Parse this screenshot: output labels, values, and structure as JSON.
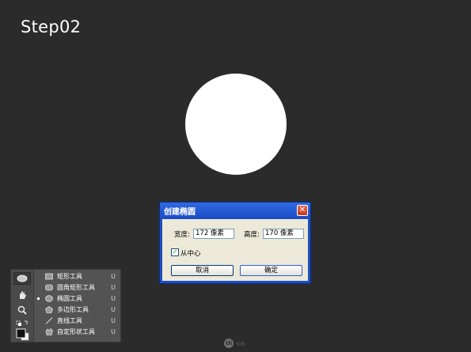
{
  "step_title": "Step02",
  "canvas": {
    "shape": "circle",
    "fill": "#ffffff"
  },
  "dialog": {
    "title": "创建椭圆",
    "close_icon": "close-icon",
    "width_label": "宽度:",
    "width_value": "172 像素",
    "height_label": "高度:",
    "height_value": "170 像素",
    "from_center_label": "从中心",
    "from_center_checked": true,
    "cancel_label": "取消",
    "ok_label": "确定"
  },
  "tools_panel": {
    "tool_icons": [
      "ellipse-icon",
      "hand-icon",
      "zoom-icon",
      "swap-colors-icon",
      "color-swatch-icon"
    ],
    "menu": [
      {
        "label": "矩形工具",
        "key": "U",
        "icon": "rectangle-icon",
        "selected": false
      },
      {
        "label": "圆角矩形工具",
        "key": "U",
        "icon": "rounded-rectangle-icon",
        "selected": false
      },
      {
        "label": "椭圆工具",
        "key": "U",
        "icon": "ellipse-icon",
        "selected": true
      },
      {
        "label": "多边形工具",
        "key": "U",
        "icon": "polygon-icon",
        "selected": false
      },
      {
        "label": "直线工具",
        "key": "U",
        "icon": "line-icon",
        "selected": false
      },
      {
        "label": "自定形状工具",
        "key": "U",
        "icon": "custom-shape-icon",
        "selected": false
      }
    ]
  },
  "watermark": {
    "logo": "Ui",
    "text": "·cn"
  }
}
